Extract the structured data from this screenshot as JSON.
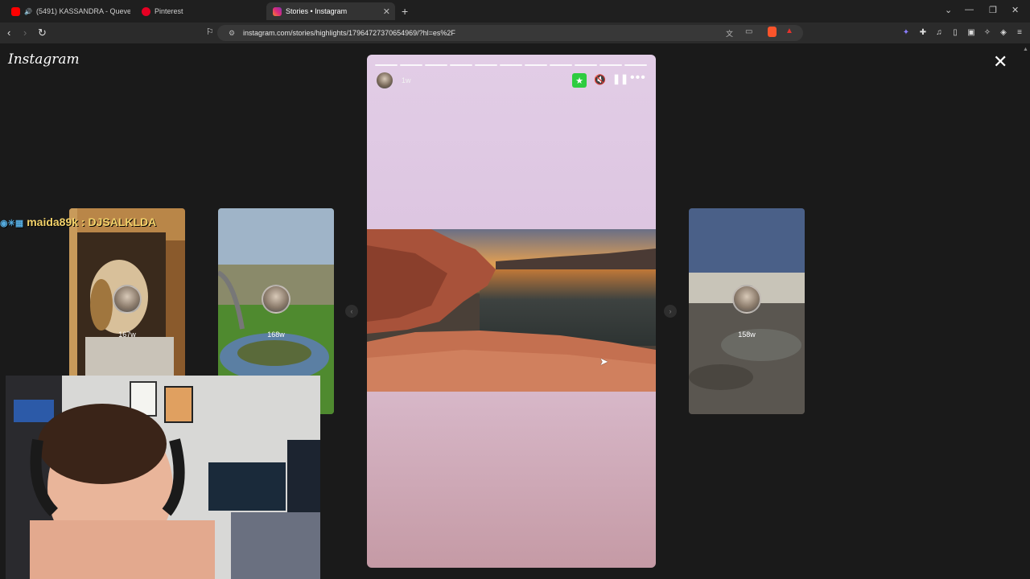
{
  "browser": {
    "tabs": [
      {
        "label": "(5491) KASSANDRA - Quevedo (...",
        "icon": "youtube-icon",
        "active": false
      },
      {
        "label": "Pinterest",
        "icon": "pinterest-icon",
        "active": false
      },
      {
        "label": "Stories • Instagram",
        "icon": "instagram-icon",
        "active": true
      }
    ],
    "url": "instagram.com/stories/highlights/17964727370654969/?hl=es%2F"
  },
  "app": {
    "logo_text": "Instagram"
  },
  "story": {
    "time": "1w",
    "segments": 11
  },
  "side_cards": [
    {
      "time": "167w",
      "name": "card-dog"
    },
    {
      "time": "168w",
      "name": "card-mate"
    },
    {
      "time": "158w",
      "name": "card-beach"
    }
  ],
  "overlay": {
    "stream_chat": "maida89k : DJSALKLDA"
  },
  "colors": {
    "accent_green": "#2ecc40",
    "background": "#1a1a1a"
  }
}
